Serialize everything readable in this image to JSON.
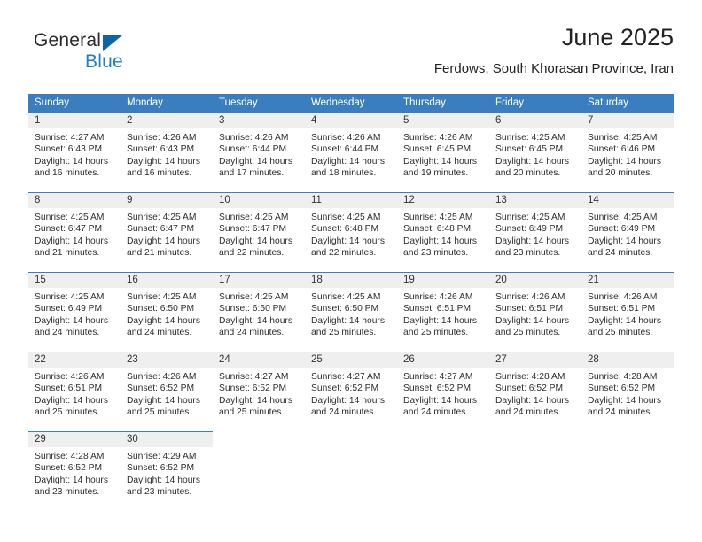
{
  "logo": {
    "primary_text": "General",
    "secondary_text": "Blue",
    "triangle_color": "#1162a8",
    "blue_color": "#1f7fc6"
  },
  "header": {
    "title": "June 2025",
    "subtitle": "Ferdows, South Khorasan Province, Iran"
  },
  "theme": {
    "header_bg": "#3a7ebf",
    "daynum_bg": "#efefef",
    "text": "#2e2e2e"
  },
  "weekdays": [
    "Sunday",
    "Monday",
    "Tuesday",
    "Wednesday",
    "Thursday",
    "Friday",
    "Saturday"
  ],
  "weeks": [
    [
      {
        "day": "1",
        "sunrise": "Sunrise: 4:27 AM",
        "sunset": "Sunset: 6:43 PM",
        "daylight1": "Daylight: 14 hours",
        "daylight2": "and 16 minutes."
      },
      {
        "day": "2",
        "sunrise": "Sunrise: 4:26 AM",
        "sunset": "Sunset: 6:43 PM",
        "daylight1": "Daylight: 14 hours",
        "daylight2": "and 16 minutes."
      },
      {
        "day": "3",
        "sunrise": "Sunrise: 4:26 AM",
        "sunset": "Sunset: 6:44 PM",
        "daylight1": "Daylight: 14 hours",
        "daylight2": "and 17 minutes."
      },
      {
        "day": "4",
        "sunrise": "Sunrise: 4:26 AM",
        "sunset": "Sunset: 6:44 PM",
        "daylight1": "Daylight: 14 hours",
        "daylight2": "and 18 minutes."
      },
      {
        "day": "5",
        "sunrise": "Sunrise: 4:26 AM",
        "sunset": "Sunset: 6:45 PM",
        "daylight1": "Daylight: 14 hours",
        "daylight2": "and 19 minutes."
      },
      {
        "day": "6",
        "sunrise": "Sunrise: 4:25 AM",
        "sunset": "Sunset: 6:45 PM",
        "daylight1": "Daylight: 14 hours",
        "daylight2": "and 20 minutes."
      },
      {
        "day": "7",
        "sunrise": "Sunrise: 4:25 AM",
        "sunset": "Sunset: 6:46 PM",
        "daylight1": "Daylight: 14 hours",
        "daylight2": "and 20 minutes."
      }
    ],
    [
      {
        "day": "8",
        "sunrise": "Sunrise: 4:25 AM",
        "sunset": "Sunset: 6:47 PM",
        "daylight1": "Daylight: 14 hours",
        "daylight2": "and 21 minutes."
      },
      {
        "day": "9",
        "sunrise": "Sunrise: 4:25 AM",
        "sunset": "Sunset: 6:47 PM",
        "daylight1": "Daylight: 14 hours",
        "daylight2": "and 21 minutes."
      },
      {
        "day": "10",
        "sunrise": "Sunrise: 4:25 AM",
        "sunset": "Sunset: 6:47 PM",
        "daylight1": "Daylight: 14 hours",
        "daylight2": "and 22 minutes."
      },
      {
        "day": "11",
        "sunrise": "Sunrise: 4:25 AM",
        "sunset": "Sunset: 6:48 PM",
        "daylight1": "Daylight: 14 hours",
        "daylight2": "and 22 minutes."
      },
      {
        "day": "12",
        "sunrise": "Sunrise: 4:25 AM",
        "sunset": "Sunset: 6:48 PM",
        "daylight1": "Daylight: 14 hours",
        "daylight2": "and 23 minutes."
      },
      {
        "day": "13",
        "sunrise": "Sunrise: 4:25 AM",
        "sunset": "Sunset: 6:49 PM",
        "daylight1": "Daylight: 14 hours",
        "daylight2": "and 23 minutes."
      },
      {
        "day": "14",
        "sunrise": "Sunrise: 4:25 AM",
        "sunset": "Sunset: 6:49 PM",
        "daylight1": "Daylight: 14 hours",
        "daylight2": "and 24 minutes."
      }
    ],
    [
      {
        "day": "15",
        "sunrise": "Sunrise: 4:25 AM",
        "sunset": "Sunset: 6:49 PM",
        "daylight1": "Daylight: 14 hours",
        "daylight2": "and 24 minutes."
      },
      {
        "day": "16",
        "sunrise": "Sunrise: 4:25 AM",
        "sunset": "Sunset: 6:50 PM",
        "daylight1": "Daylight: 14 hours",
        "daylight2": "and 24 minutes."
      },
      {
        "day": "17",
        "sunrise": "Sunrise: 4:25 AM",
        "sunset": "Sunset: 6:50 PM",
        "daylight1": "Daylight: 14 hours",
        "daylight2": "and 24 minutes."
      },
      {
        "day": "18",
        "sunrise": "Sunrise: 4:25 AM",
        "sunset": "Sunset: 6:50 PM",
        "daylight1": "Daylight: 14 hours",
        "daylight2": "and 25 minutes."
      },
      {
        "day": "19",
        "sunrise": "Sunrise: 4:26 AM",
        "sunset": "Sunset: 6:51 PM",
        "daylight1": "Daylight: 14 hours",
        "daylight2": "and 25 minutes."
      },
      {
        "day": "20",
        "sunrise": "Sunrise: 4:26 AM",
        "sunset": "Sunset: 6:51 PM",
        "daylight1": "Daylight: 14 hours",
        "daylight2": "and 25 minutes."
      },
      {
        "day": "21",
        "sunrise": "Sunrise: 4:26 AM",
        "sunset": "Sunset: 6:51 PM",
        "daylight1": "Daylight: 14 hours",
        "daylight2": "and 25 minutes."
      }
    ],
    [
      {
        "day": "22",
        "sunrise": "Sunrise: 4:26 AM",
        "sunset": "Sunset: 6:51 PM",
        "daylight1": "Daylight: 14 hours",
        "daylight2": "and 25 minutes."
      },
      {
        "day": "23",
        "sunrise": "Sunrise: 4:26 AM",
        "sunset": "Sunset: 6:52 PM",
        "daylight1": "Daylight: 14 hours",
        "daylight2": "and 25 minutes."
      },
      {
        "day": "24",
        "sunrise": "Sunrise: 4:27 AM",
        "sunset": "Sunset: 6:52 PM",
        "daylight1": "Daylight: 14 hours",
        "daylight2": "and 25 minutes."
      },
      {
        "day": "25",
        "sunrise": "Sunrise: 4:27 AM",
        "sunset": "Sunset: 6:52 PM",
        "daylight1": "Daylight: 14 hours",
        "daylight2": "and 24 minutes."
      },
      {
        "day": "26",
        "sunrise": "Sunrise: 4:27 AM",
        "sunset": "Sunset: 6:52 PM",
        "daylight1": "Daylight: 14 hours",
        "daylight2": "and 24 minutes."
      },
      {
        "day": "27",
        "sunrise": "Sunrise: 4:28 AM",
        "sunset": "Sunset: 6:52 PM",
        "daylight1": "Daylight: 14 hours",
        "daylight2": "and 24 minutes."
      },
      {
        "day": "28",
        "sunrise": "Sunrise: 4:28 AM",
        "sunset": "Sunset: 6:52 PM",
        "daylight1": "Daylight: 14 hours",
        "daylight2": "and 24 minutes."
      }
    ],
    [
      {
        "day": "29",
        "sunrise": "Sunrise: 4:28 AM",
        "sunset": "Sunset: 6:52 PM",
        "daylight1": "Daylight: 14 hours",
        "daylight2": "and 23 minutes."
      },
      {
        "day": "30",
        "sunrise": "Sunrise: 4:29 AM",
        "sunset": "Sunset: 6:52 PM",
        "daylight1": "Daylight: 14 hours",
        "daylight2": "and 23 minutes."
      },
      {
        "day": "",
        "sunrise": "",
        "sunset": "",
        "daylight1": "",
        "daylight2": ""
      },
      {
        "day": "",
        "sunrise": "",
        "sunset": "",
        "daylight1": "",
        "daylight2": ""
      },
      {
        "day": "",
        "sunrise": "",
        "sunset": "",
        "daylight1": "",
        "daylight2": ""
      },
      {
        "day": "",
        "sunrise": "",
        "sunset": "",
        "daylight1": "",
        "daylight2": ""
      },
      {
        "day": "",
        "sunrise": "",
        "sunset": "",
        "daylight1": "",
        "daylight2": ""
      }
    ]
  ]
}
